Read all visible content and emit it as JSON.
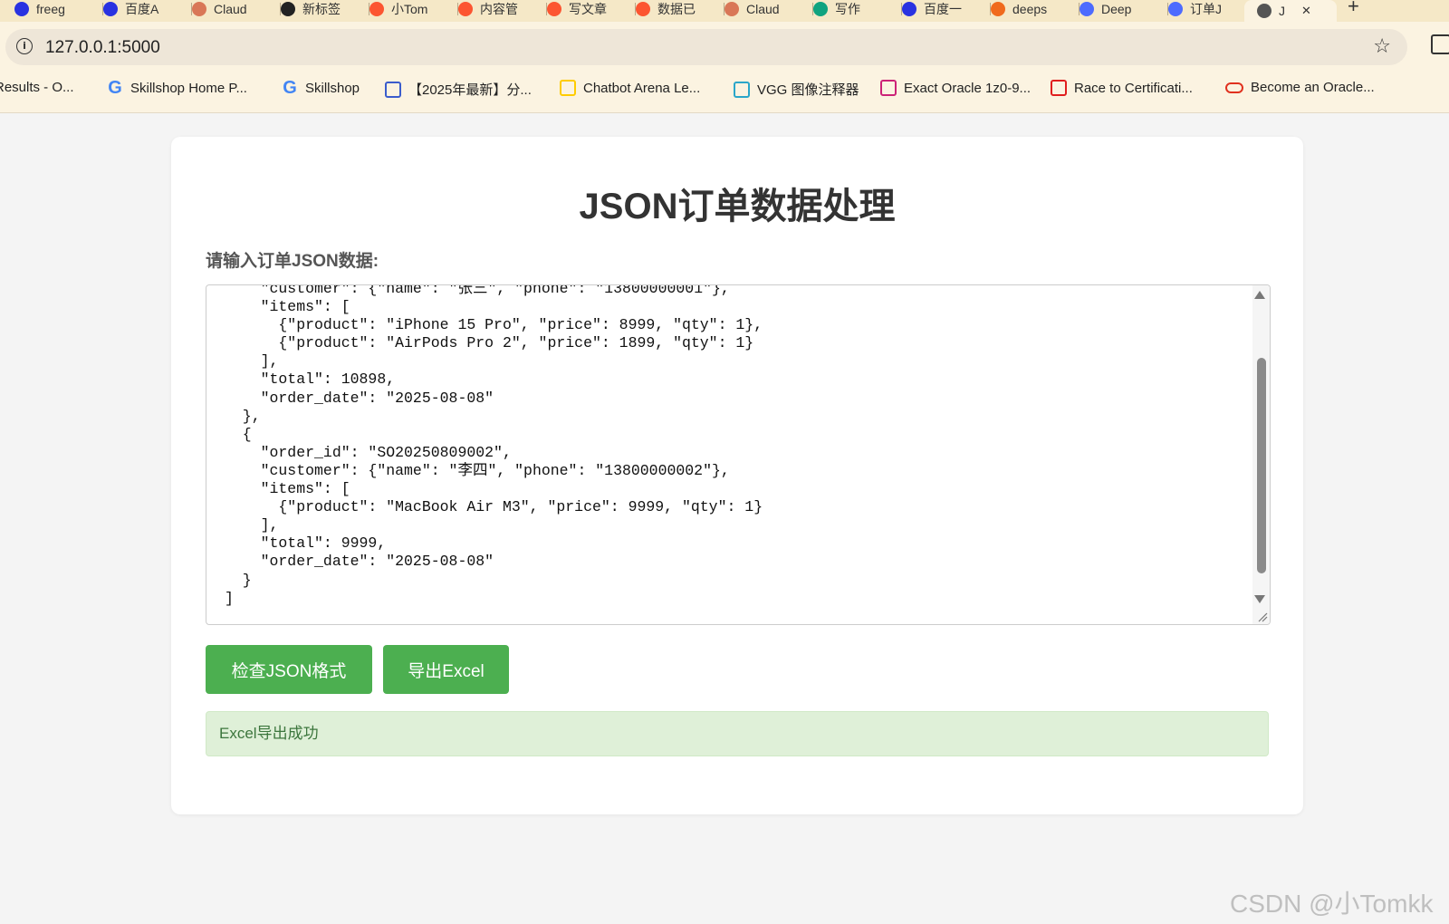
{
  "browser": {
    "tabs": [
      {
        "label": "freeg",
        "icon": "baidu-paw-icon",
        "color": "#2932e1"
      },
      {
        "label": "百度A",
        "icon": "baidu-paw-icon",
        "color": "#2932e1"
      },
      {
        "label": "Claud",
        "icon": "claude-icon",
        "color": "#d97757"
      },
      {
        "label": "新标签",
        "icon": "github-icon",
        "color": "#222222"
      },
      {
        "label": "小Tom",
        "icon": "csdn-icon",
        "color": "#fc5531"
      },
      {
        "label": "内容管",
        "icon": "csdn-icon",
        "color": "#fc5531"
      },
      {
        "label": "写文章",
        "icon": "csdn-icon",
        "color": "#fc5531"
      },
      {
        "label": "数据已",
        "icon": "csdn-icon",
        "color": "#fc5531"
      },
      {
        "label": "Claud",
        "icon": "claude-icon",
        "color": "#d97757"
      },
      {
        "label": "写作",
        "icon": "chatgpt-icon",
        "color": "#10a37f"
      },
      {
        "label": "百度一",
        "icon": "baidu-paw-icon",
        "color": "#2932e1"
      },
      {
        "label": "deeps",
        "icon": "deepseek-icon",
        "color": "#f06a1d"
      },
      {
        "label": "Deep",
        "icon": "deepseek-whale-icon",
        "color": "#4d6bfe"
      },
      {
        "label": "订单J",
        "icon": "deepseek-whale-icon",
        "color": "#4d6bfe"
      },
      {
        "label": "J",
        "icon": "globe-icon",
        "color": "#555555"
      }
    ],
    "close_glyph": "✕",
    "new_tab_glyph": "+",
    "url": "127.0.0.1:5000",
    "bookmarks": [
      {
        "label": "Results - O...",
        "icon": "",
        "color": "#000000"
      },
      {
        "label": "Skillshop Home P...",
        "icon": "google-icon",
        "color": "#4285f4"
      },
      {
        "label": "Skillshop",
        "icon": "google-icon",
        "color": "#4285f4"
      },
      {
        "label": "【2025年最新】分...",
        "icon": "thumbs-up-icon",
        "color": "#3a5ccc"
      },
      {
        "label": "Chatbot Arena Le...",
        "icon": "hugging-face-icon",
        "color": "#ffcc00"
      },
      {
        "label": "VGG 图像注释器",
        "icon": "vgg-icon",
        "color": "#2aa6c9"
      },
      {
        "label": "Exact Oracle 1z0-9...",
        "icon": "exact-e-icon",
        "color": "#cc2277"
      },
      {
        "label": "Race to Certificati...",
        "icon": "oracle-square-icon",
        "color": "#e01e1e"
      },
      {
        "label": "Become an Oracle...",
        "icon": "oracle-oval-icon",
        "color": "#e0301e"
      }
    ]
  },
  "page": {
    "title": "JSON订单数据处理",
    "input_label": "请输入订单JSON数据:",
    "json_text": "    \"customer\": {\"name\": \"张三\", \"phone\": \"13800000001\"},\n    \"items\": [\n      {\"product\": \"iPhone 15 Pro\", \"price\": 8999, \"qty\": 1},\n      {\"product\": \"AirPods Pro 2\", \"price\": 1899, \"qty\": 1}\n    ],\n    \"total\": 10898,\n    \"order_date\": \"2025-08-08\"\n  },\n  {\n    \"order_id\": \"SO20250809002\",\n    \"customer\": {\"name\": \"李四\", \"phone\": \"13800000002\"},\n    \"items\": [\n      {\"product\": \"MacBook Air M3\", \"price\": 9999, \"qty\": 1}\n    ],\n    \"total\": 9999,\n    \"order_date\": \"2025-08-08\"\n  }\n]",
    "check_button": "检查JSON格式",
    "export_button": "导出Excel",
    "result_message": "Excel导出成功",
    "accent_color": "#4caf50"
  },
  "watermark": "CSDN @小Tomkk"
}
